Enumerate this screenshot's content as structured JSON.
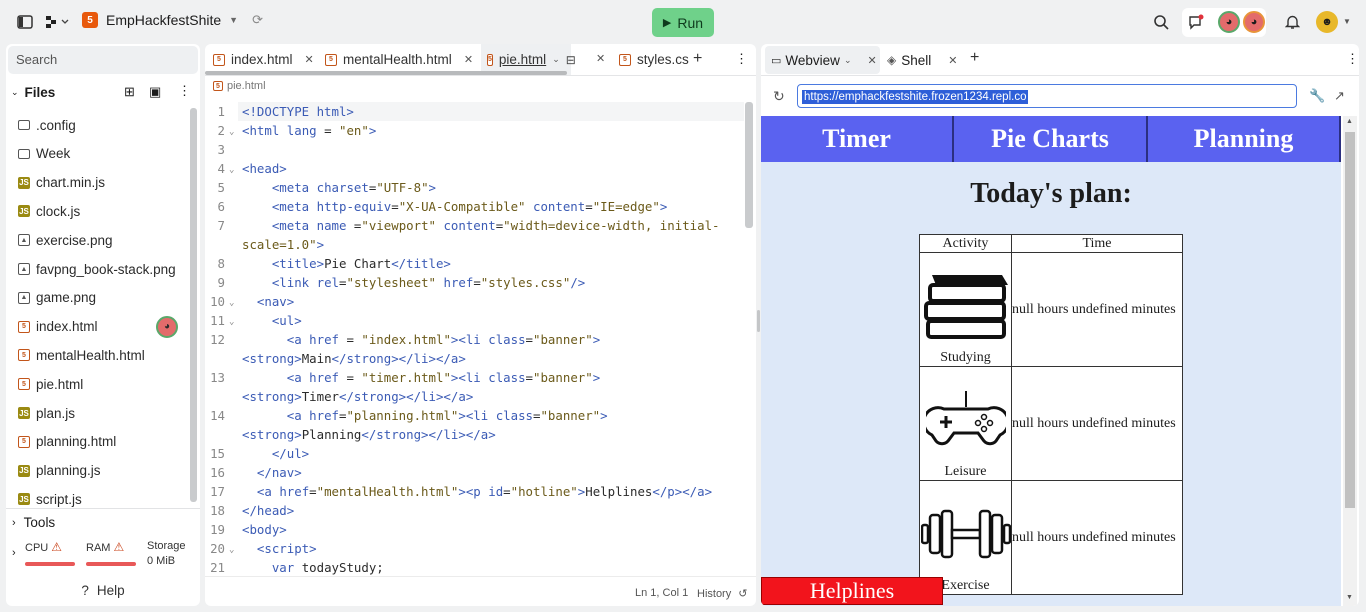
{
  "topbar": {
    "project_name": "EmpHackfestShite",
    "run_label": "Run"
  },
  "sidebar": {
    "search_placeholder": "Search",
    "files_label": "Files",
    "files": [
      {
        "name": ".config",
        "icon": "folder-icon"
      },
      {
        "name": "Week",
        "icon": "folder-icon"
      },
      {
        "name": "chart.min.js",
        "icon": "js-file-icon"
      },
      {
        "name": "clock.js",
        "icon": "js-file-icon"
      },
      {
        "name": "exercise.png",
        "icon": "image-file-icon"
      },
      {
        "name": "favpng_book-stack.png",
        "icon": "image-file-icon"
      },
      {
        "name": "game.png",
        "icon": "image-file-icon"
      },
      {
        "name": "index.html",
        "icon": "html-file-icon"
      },
      {
        "name": "mentalHealth.html",
        "icon": "html-file-icon"
      },
      {
        "name": "pie.html",
        "icon": "html-file-icon"
      },
      {
        "name": "plan.js",
        "icon": "js-file-icon"
      },
      {
        "name": "planning.html",
        "icon": "html-file-icon"
      },
      {
        "name": "planning.js",
        "icon": "js-file-icon"
      },
      {
        "name": "script.js",
        "icon": "js-file-icon"
      }
    ],
    "tools_label": "Tools",
    "cpu_label": "CPU",
    "ram_label": "RAM",
    "storage_label": "Storage",
    "storage_value": "0 MiB",
    "help_label": "Help"
  },
  "editor": {
    "tabs": [
      "index.html",
      "mentalHealth.html",
      "pie.html",
      "styles.cs"
    ],
    "breadcrumb": "pie.html",
    "cursor_position": "Ln 1, Col 1",
    "history_label": "History"
  },
  "webview": {
    "tabs": [
      "Webview",
      "Shell"
    ],
    "url": "https://emphackfestshite.frozen1234.repl.co",
    "nav_items": [
      "Timer",
      "Pie Charts",
      "Planning"
    ],
    "plan_title": "Today's plan:",
    "table_headers": [
      "Activity",
      "Time"
    ],
    "rows": [
      {
        "activity": "Studying",
        "time": "null hours undefined minutes"
      },
      {
        "activity": "Leisure",
        "time": "null hours undefined minutes"
      },
      {
        "activity": "Exercise",
        "time": "null hours undefined minutes"
      }
    ],
    "helplines_label": "Helplines"
  }
}
